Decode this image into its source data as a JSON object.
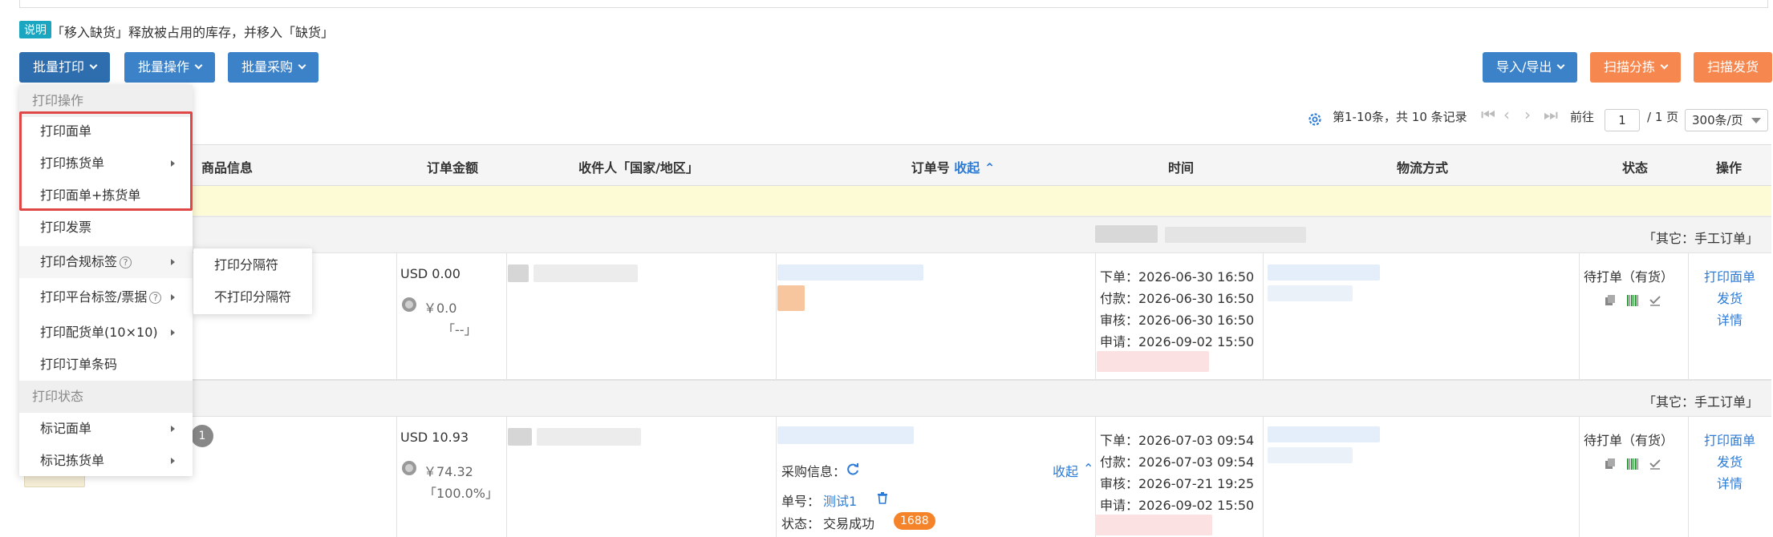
{
  "note": {
    "badge": "说明",
    "text": "「移入缺货」释放被占用的库存，并移入「缺货」"
  },
  "toolbar": {
    "batch_print": "批量打印",
    "batch_ops": "批量操作",
    "batch_purchase": "批量采购",
    "import_export": "导入/导出",
    "scan_sort": "扫描分拣",
    "scan_ship": "扫描发货"
  },
  "pager": {
    "summary": "第1-10条，共 10 条记录",
    "goto": "前往",
    "page": "1",
    "total": "/ 1 页",
    "per_page": "300条/页"
  },
  "table": {
    "headers": {
      "product": "商品信息",
      "amount": "订单金额",
      "recipient": "收件人「国家/地区」",
      "order_no": "订单号",
      "collapse": "收起",
      "time": "时间",
      "logistics": "物流方式",
      "status": "状态",
      "actions": "操作"
    },
    "groups": [
      {
        "label": "「其它：手工订单」"
      },
      {
        "label": "「其它：手工订单」"
      }
    ],
    "rows": [
      {
        "amount_usd": "USD 0.00",
        "amount_cny": "￥0.0",
        "ratio": "「--」",
        "times": [
          "下单：2026-06-30 16:50",
          "付款：2026-06-30 16:50",
          "审核：2026-06-30 16:50",
          "申请：2026-09-02 15:50"
        ],
        "status": "待打单（有货）",
        "actions": [
          "打印面单",
          "发货",
          "详情"
        ]
      },
      {
        "badge": "1",
        "amount_usd": "USD 10.93",
        "amount_cny": "￥74.32",
        "ratio": "「100.0%」",
        "purchase_label": "采购信息：",
        "collapse": "收起",
        "order_label": "单号：",
        "order_link": "测试1",
        "state_label": "状态：",
        "state_value": "交易成功",
        "state_badge": "1688",
        "times": [
          "下单：2026-07-03 09:54",
          "付款：2026-07-03 09:54",
          "审核：2026-07-21 19:25",
          "申请：2026-09-02 15:50"
        ],
        "status": "待打单（有货）",
        "actions": [
          "打印面单",
          "发货",
          "详情"
        ]
      }
    ]
  },
  "menu": {
    "section_print": "打印操作",
    "items": [
      "打印面单",
      "打印拣货单",
      "打印面单+拣货单",
      "打印发票",
      "打印合规标签",
      "打印平台标签/票据",
      "打印配货单(10×10)",
      "打印订单条码"
    ],
    "section_status": "打印状态",
    "status_items": [
      "标记面单",
      "标记拣货单"
    ],
    "help": "?"
  },
  "submenu": {
    "items": [
      "打印分隔符",
      "不打印分隔符"
    ]
  },
  "colors": {
    "primary": "#3c82c8",
    "orange": "#f6874e",
    "highlight": "#e04848",
    "yellow_row": "#fdfbd6"
  }
}
